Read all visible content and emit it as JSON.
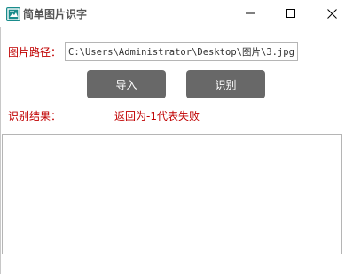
{
  "window": {
    "title": "简单图片识字",
    "app_icon": "image-text-app-icon",
    "controls": {
      "minimize_icon": "minimize-icon",
      "maximize_icon": "maximize-icon",
      "close_icon": "close-icon"
    }
  },
  "form": {
    "path_label": "图片路径：",
    "path_value": "C:\\Users\\Administrator\\Desktop\\图片\\3.jpg",
    "import_button": "导入",
    "recognize_button": "识别",
    "result_label": "识别结果：",
    "result_status": "返回为-1代表失败",
    "result_text": ""
  },
  "colors": {
    "label_red": "#c00000",
    "button_gray": "#686868",
    "button_text": "#ffffff",
    "app_icon_teal": "#1a8c8c"
  }
}
